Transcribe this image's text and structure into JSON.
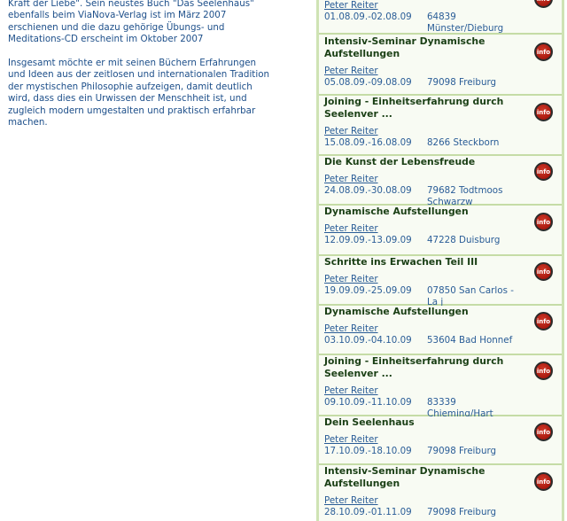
{
  "bio": {
    "paragraph1": "Kraft der Liebe\". Sein neustes Buch \"Das Seelenhaus\" ebenfalls beim ViaNova-Verlag ist im März 2007 erschienen und die dazu gehörige Übungs- und Meditations-CD erscheint im Oktober 2007",
    "paragraph2": "Insgesamt möchte er mit seinen Büchern Erfahrungen und Ideen aus der zeitlosen und internationalen Tradition der mystischen Philosophie aufzeigen, damit deutlich wird, dass dies ein Urwissen der Menschheit ist, und zugleich modern umgestalten und praktisch erfahrbar machen."
  },
  "info_label": "info",
  "events": [
    {
      "title": "",
      "author": "Peter Reiter",
      "date": "01.08.09.-02.08.09",
      "place": "64839 Münster/Dieburg"
    },
    {
      "title": "Intensiv-Seminar Dynamische Aufstellungen",
      "author": "Peter Reiter",
      "date": "05.08.09.-09.08.09",
      "place": "79098 Freiburg"
    },
    {
      "title": "Joining - Einheitserfahrung durch Seelenver ...",
      "author": "Peter Reiter",
      "date": "15.08.09.-16.08.09",
      "place": "8266 Steckborn"
    },
    {
      "title": "Die Kunst der Lebensfreude",
      "author": "Peter Reiter",
      "date": "24.08.09.-30.08.09",
      "place": "79682 Todtmoos Schwarzw"
    },
    {
      "title": "Dynamische Aufstellungen",
      "author": "Peter Reiter",
      "date": "12.09.09.-13.09.09",
      "place": "47228 Duisburg"
    },
    {
      "title": "Schritte ins Erwachen Teil III",
      "author": "Peter Reiter",
      "date": "19.09.09.-25.09.09",
      "place": "07850 San Carlos - La j"
    },
    {
      "title": "Dynamische Aufstellungen",
      "author": "Peter Reiter",
      "date": "03.10.09.-04.10.09",
      "place": "53604 Bad Honnef"
    },
    {
      "title": "Joining - Einheitserfahrung durch Seelenver ...",
      "author": "Peter Reiter",
      "date": "09.10.09.-11.10.09",
      "place": "83339 Chieming/Hart"
    },
    {
      "title": "Dein Seelenhaus",
      "author": "Peter Reiter",
      "date": "17.10.09.-18.10.09",
      "place": "79098 Freiburg"
    },
    {
      "title": "Intensiv-Seminar Dynamische Aufstellungen",
      "author": "Peter Reiter",
      "date": "28.10.09.-01.11.09",
      "place": "79098 Freiburg"
    }
  ]
}
